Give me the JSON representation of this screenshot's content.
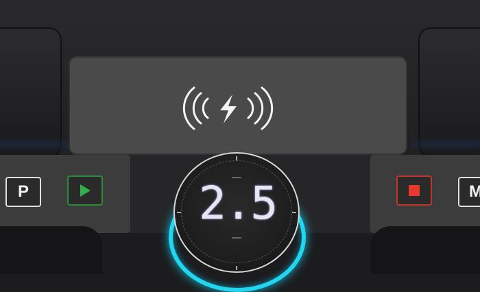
{
  "display": {
    "value": "2.5"
  },
  "charging_pad": {
    "icon": "wireless-charging-icon"
  },
  "keys": {
    "park_label": "P",
    "play_icon": "play-icon",
    "stop_icon": "stop-icon",
    "mode_label": "M"
  },
  "colors": {
    "play_accent": "#2eb04a",
    "stop_accent": "#e8392e",
    "dial_glow": "#23d6f0",
    "pad": "#4a4a4a"
  }
}
